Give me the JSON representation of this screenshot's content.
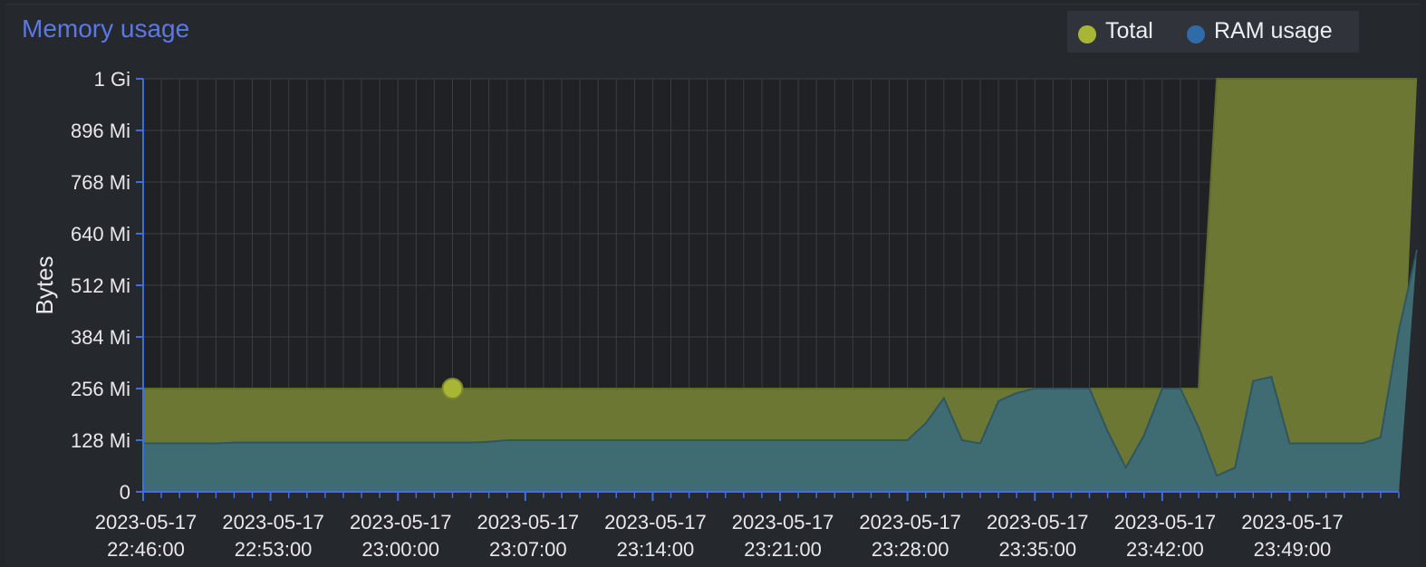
{
  "colors": {
    "title": "#5b78e6",
    "total": "#a8b535",
    "total_fill": "#6c7733",
    "ram": "#2f6ba8",
    "ram_fill": "#3f6b72",
    "ram_line": "#2f5660",
    "axis": "#3d6fe0",
    "grid": "#3a3e44",
    "plot_bg": "#1f2125",
    "text": "#e6e8ea"
  },
  "chart_data": {
    "type": "area",
    "title": "Memory usage",
    "xlabel": "",
    "ylabel": "Bytes",
    "ylim": [
      0,
      1024
    ],
    "y_unit": "Mi",
    "y_ticks": [
      0,
      128,
      256,
      384,
      512,
      640,
      768,
      896,
      1024
    ],
    "y_tick_labels": [
      "0",
      "128 Mi",
      "256 Mi",
      "384 Mi",
      "512 Mi",
      "640 Mi",
      "768 Mi",
      "896 Mi",
      "1 Gi"
    ],
    "x_range": [
      "2023-05-17 22:46:00",
      "2023-05-17 23:55:00"
    ],
    "x_ticks": [
      {
        "date": "2023-05-17",
        "time": "22:46:00"
      },
      {
        "date": "2023-05-17",
        "time": "22:53:00"
      },
      {
        "date": "2023-05-17",
        "time": "23:00:00"
      },
      {
        "date": "2023-05-17",
        "time": "23:07:00"
      },
      {
        "date": "2023-05-17",
        "time": "23:14:00"
      },
      {
        "date": "2023-05-17",
        "time": "23:21:00"
      },
      {
        "date": "2023-05-17",
        "time": "23:28:00"
      },
      {
        "date": "2023-05-17",
        "time": "23:35:00"
      },
      {
        "date": "2023-05-17",
        "time": "23:42:00"
      },
      {
        "date": "2023-05-17",
        "time": "23:49:00"
      }
    ],
    "legend_position": "top-right",
    "grid": true,
    "x": [
      "22:46",
      "22:47",
      "22:48",
      "22:49",
      "22:50",
      "22:51",
      "22:52",
      "22:53",
      "22:54",
      "22:55",
      "22:56",
      "22:57",
      "22:58",
      "22:59",
      "23:00",
      "23:01",
      "23:02",
      "23:03",
      "23:04",
      "23:05",
      "23:06",
      "23:07",
      "23:08",
      "23:09",
      "23:10",
      "23:11",
      "23:12",
      "23:13",
      "23:14",
      "23:15",
      "23:16",
      "23:17",
      "23:18",
      "23:19",
      "23:20",
      "23:21",
      "23:22",
      "23:23",
      "23:24",
      "23:25",
      "23:26",
      "23:27",
      "23:28",
      "23:29",
      "23:30",
      "23:31",
      "23:32",
      "23:33",
      "23:34",
      "23:35",
      "23:36",
      "23:37",
      "23:38",
      "23:39",
      "23:40",
      "23:41",
      "23:42",
      "23:43",
      "23:44",
      "23:45",
      "23:46",
      "23:47",
      "23:48",
      "23:49",
      "23:50",
      "23:51",
      "23:52",
      "23:53",
      "23:54",
      "23:55"
    ],
    "series": [
      {
        "name": "Total",
        "values": [
          256,
          256,
          256,
          256,
          256,
          256,
          256,
          256,
          256,
          256,
          256,
          256,
          256,
          256,
          256,
          256,
          256,
          256,
          256,
          256,
          256,
          256,
          256,
          256,
          256,
          256,
          256,
          256,
          256,
          256,
          256,
          256,
          256,
          256,
          256,
          256,
          256,
          256,
          256,
          256,
          256,
          256,
          256,
          256,
          256,
          256,
          256,
          256,
          256,
          256,
          256,
          256,
          256,
          256,
          256,
          256,
          256,
          256,
          256,
          1024,
          1024,
          1024,
          1024,
          1024,
          1024,
          1024,
          1024,
          1024,
          1024,
          1024,
          1024
        ],
        "highlight_point": {
          "x": "23:03",
          "y": 256
        }
      },
      {
        "name": "RAM usage",
        "values": [
          120,
          120,
          120,
          120,
          120,
          122,
          122,
          122,
          122,
          122,
          122,
          122,
          122,
          122,
          122,
          122,
          122,
          122,
          122,
          124,
          128,
          128,
          128,
          128,
          128,
          128,
          128,
          128,
          128,
          128,
          128,
          128,
          128,
          128,
          128,
          128,
          128,
          128,
          128,
          128,
          128,
          128,
          128,
          170,
          232,
          128,
          120,
          225,
          245,
          256,
          256,
          256,
          256,
          150,
          60,
          140,
          256,
          256,
          160,
          40,
          60,
          275,
          285,
          120,
          120,
          120,
          120,
          120,
          135,
          400,
          600
        ]
      }
    ]
  }
}
